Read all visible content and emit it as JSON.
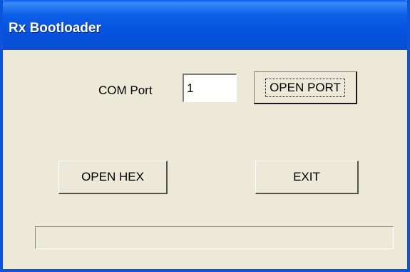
{
  "window": {
    "title": "Rx Bootloader"
  },
  "com_port": {
    "label": "COM Port",
    "value": "1"
  },
  "buttons": {
    "open_port": "OPEN PORT",
    "open_hex": "OPEN HEX",
    "exit": "EXIT"
  },
  "progress": {
    "value": 0
  },
  "colors": {
    "titlebar": "#0a55d9",
    "window_bg": "#ece9d8",
    "title_text": "#ffffff"
  }
}
